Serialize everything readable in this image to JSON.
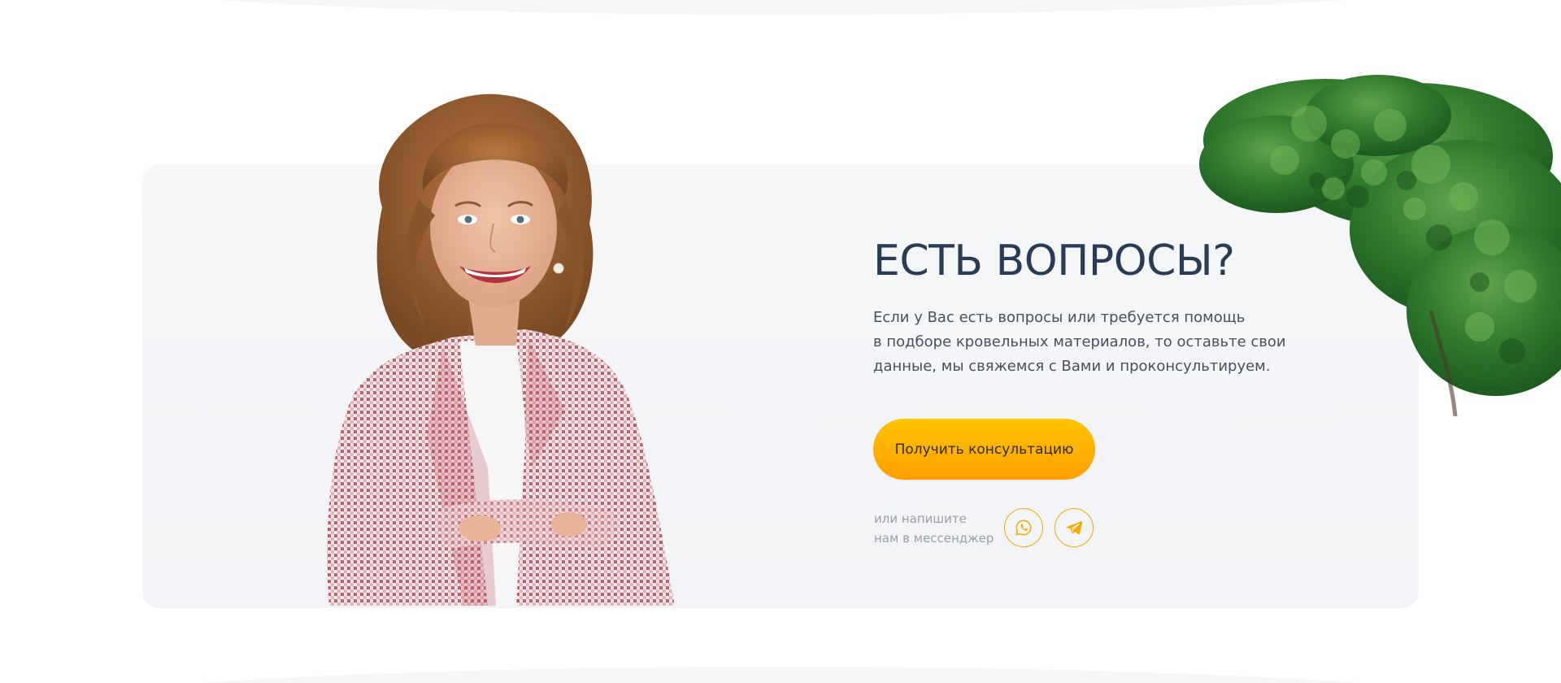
{
  "section": {
    "title": "ЕСТЬ ВОПРОСЫ?",
    "description_lines": [
      "Если у Вас есть вопросы или требуется помощь",
      "в подборе кровельных материалов, то оставьте свои",
      "данные, мы свяжемся с Вами и проконсультируем."
    ],
    "cta_label": "Получить консультацию",
    "messenger_note_lines": [
      "или напишите",
      "нам в мессенджер"
    ]
  },
  "icons": {
    "whatsapp": "whatsapp-icon",
    "telegram": "telegram-icon"
  },
  "colors": {
    "title": "#2a3b55",
    "text": "#4a4f5c",
    "muted": "#9a9ea8",
    "accent_top": "#ffc400",
    "accent_bottom": "#ff9f00",
    "card_bg": "#f4f5f8"
  }
}
